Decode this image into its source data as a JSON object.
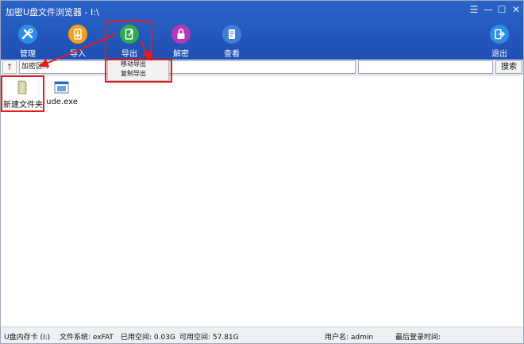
{
  "window": {
    "title": "加密U盘文件浏览器 - I:\\",
    "controls": [
      "☰",
      "—",
      "☐",
      "✕"
    ]
  },
  "toolbar": {
    "items": [
      {
        "label": "管理",
        "icon": "wrench-screwdriver-icon",
        "color": "#2c8ee8"
      },
      {
        "label": "导入",
        "icon": "import-icon",
        "color": "#f0a21a"
      },
      {
        "label": "导出",
        "icon": "export-icon",
        "color": "#2fa84f"
      },
      {
        "label": "解密",
        "icon": "lock-icon",
        "color": "#b33ab7"
      },
      {
        "label": "查看",
        "icon": "document-view-icon",
        "color": "#3f7fd8"
      },
      {
        "label": "退出",
        "icon": "exit-icon",
        "color": "#2c8ee8"
      }
    ]
  },
  "address": {
    "up_symbol": "↑",
    "path": "加密区:\\",
    "search_value": "",
    "search_label": "搜索"
  },
  "export_menu": {
    "items": [
      "移动导出",
      "复制导出"
    ]
  },
  "files": [
    {
      "name": "新建文件夹",
      "type": "folder-icon"
    },
    {
      "name": "ude.exe",
      "type": "exe-file-icon"
    }
  ],
  "status": {
    "drive": "U盘内存卡 (I:)",
    "filesystem": "文件系统: exFAT",
    "used": "已用空间: 0.03G",
    "free": "可用空间: 57.81G",
    "user": "用户名: admin",
    "last_login": "最后登录时间:"
  },
  "colors": {
    "titlebar": "#2a63c9",
    "annotation": "#e31c1c"
  }
}
